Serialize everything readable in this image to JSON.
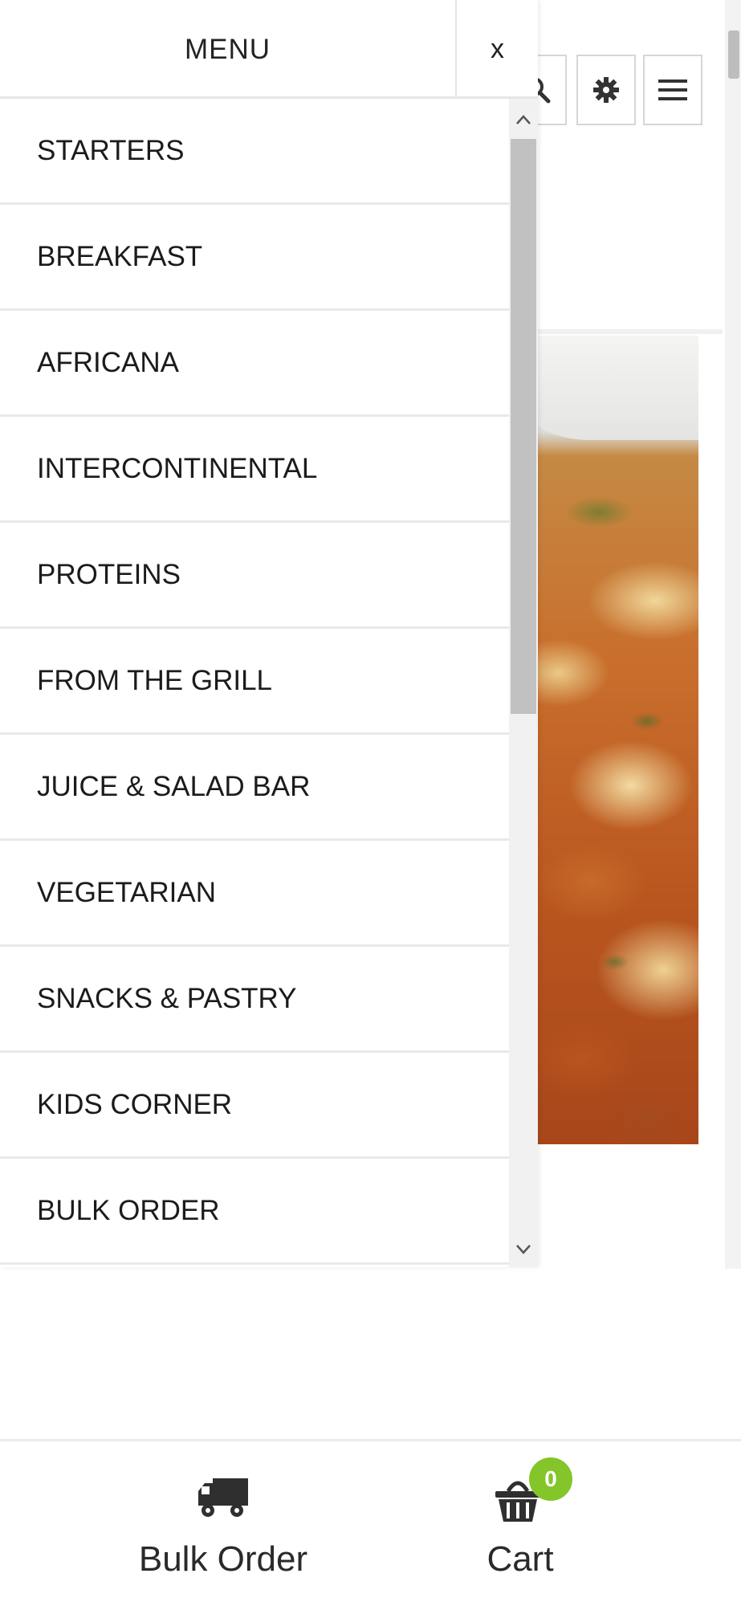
{
  "menu": {
    "title": "MENU",
    "close_label": "x",
    "items": [
      "STARTERS",
      "BREAKFAST",
      "AFRICANA",
      "INTERCONTINENTAL",
      "PROTEINS",
      "FROM THE GRILL",
      "JUICE & SALAD BAR",
      "VEGETARIAN",
      "SNACKS & PASTRY",
      "KIDS CORNER",
      "BULK ORDER"
    ]
  },
  "header": {
    "icons": [
      "search-icon",
      "gear-icon",
      "hamburger-icon"
    ]
  },
  "bottom_nav": {
    "bulk_order_label": "Bulk Order",
    "cart_label": "Cart",
    "cart_count": "0"
  },
  "colors": {
    "badge": "#84c52a",
    "divider": "#e9e9e9"
  }
}
